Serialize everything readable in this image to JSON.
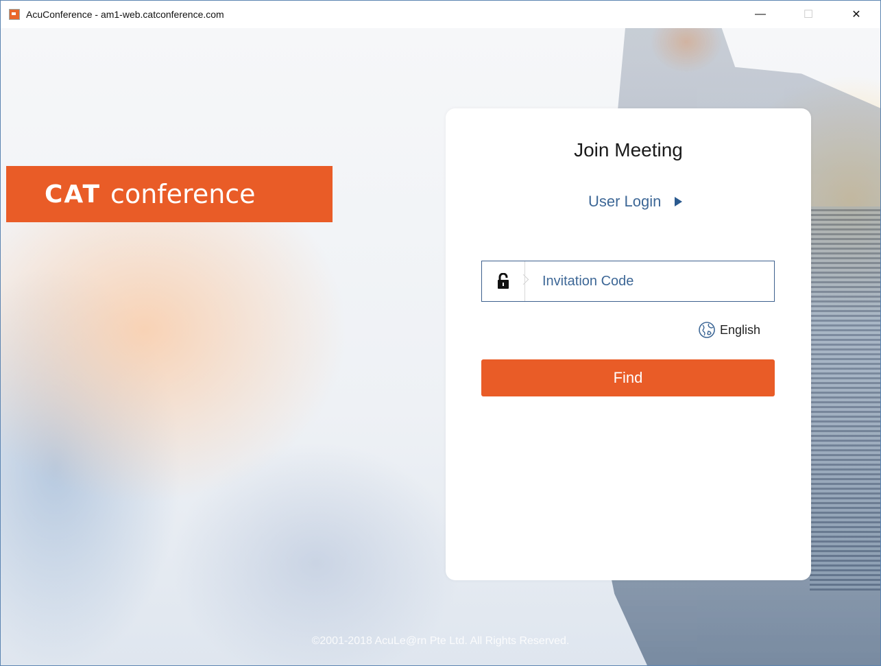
{
  "window": {
    "title": "AcuConference - am1-web.catconference.com",
    "controls": {
      "minimize": "—",
      "maximize": "☐",
      "close": "✕"
    }
  },
  "brand": {
    "logo_bold": "CAT",
    "logo_light": "conference",
    "accent_color": "#e95c27"
  },
  "card": {
    "title": "Join Meeting",
    "user_login_label": "User Login",
    "invitation": {
      "placeholder": "Invitation Code",
      "value": ""
    },
    "language_label": "English",
    "find_label": "Find"
  },
  "footer": {
    "copyright": "©2001-2018 AcuLe@rn Pte Ltd. All Rights Reserved."
  },
  "icons": [
    "app-icon",
    "lock-icon",
    "chevron-right-icon",
    "globe-icon",
    "play-arrow-icon"
  ]
}
